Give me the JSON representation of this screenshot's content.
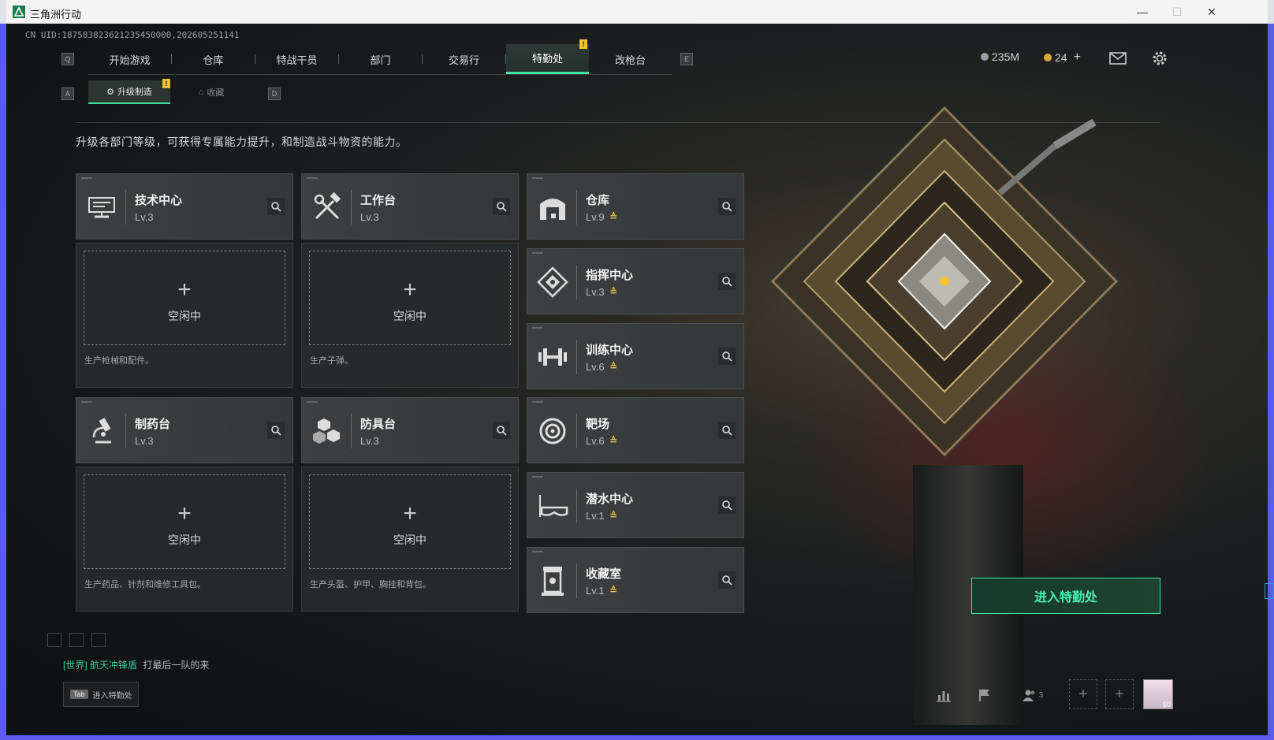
{
  "window": {
    "title": "三角洲行动",
    "minimize": "—",
    "maximize": "☐",
    "close": "✕"
  },
  "uid": "CN UID:187583823621235450000,202605251141",
  "key_hints": {
    "prev_tab": "Q",
    "next_tab": "E",
    "prev_sub": "A",
    "next_sub": "D"
  },
  "topnav": {
    "tabs": [
      "开始游戏",
      "仓库",
      "特战干员",
      "部门",
      "交易行",
      "特勤处",
      "改枪台"
    ],
    "active": "特勤处",
    "badge": "!"
  },
  "currency": {
    "silver": "235M",
    "gold": "24",
    "add": "+"
  },
  "subnav": {
    "tabs": [
      "升级制造",
      "收藏"
    ],
    "active": "升级制造",
    "badge": "!"
  },
  "description": "升级各部门等级，可获得专属能力提升，和制造战斗物资的能力。",
  "production": [
    {
      "name": "技术中心",
      "level": "Lv.3",
      "slot": {
        "plus": "+",
        "status": "空闲中",
        "desc": "生产枪械和配件。"
      }
    },
    {
      "name": "工作台",
      "level": "Lv.3",
      "slot": {
        "plus": "+",
        "status": "空闲中",
        "desc": "生产子弹。"
      }
    },
    {
      "name": "制药台",
      "level": "Lv.3",
      "slot": {
        "plus": "+",
        "status": "空闲中",
        "desc": "生产药品、针剂和维修工具包。"
      }
    },
    {
      "name": "防具台",
      "level": "Lv.3",
      "slot": {
        "plus": "+",
        "status": "空闲中",
        "desc": "生产头盔、护甲、胸挂和背包。"
      }
    }
  ],
  "facilities": [
    {
      "name": "仓库",
      "level": "Lv.9",
      "upgrade": "≙"
    },
    {
      "name": "指挥中心",
      "level": "Lv.3",
      "upgrade": "≙"
    },
    {
      "name": "训练中心",
      "level": "Lv.6",
      "upgrade": "≙"
    },
    {
      "name": "靶场",
      "level": "Lv.6",
      "upgrade": "≙"
    },
    {
      "name": "潜水中心",
      "level": "Lv.1",
      "upgrade": "≙"
    },
    {
      "name": "收藏室",
      "level": "Lv.1",
      "upgrade": "≙"
    }
  ],
  "enter_button": "进入特勤处",
  "chat": {
    "channel": "[世界]",
    "user": "航天冲锋盾",
    "message": "打最后一队的来"
  },
  "tab_hint": {
    "key": "Tab",
    "label": "进入特勤处"
  },
  "bottom": {
    "friends_count": "3",
    "avatar_level": "60",
    "add": "+"
  },
  "colors": {
    "accent": "#3ee3a3",
    "upgrade": "#f0c341",
    "badge": "#f2c230"
  }
}
